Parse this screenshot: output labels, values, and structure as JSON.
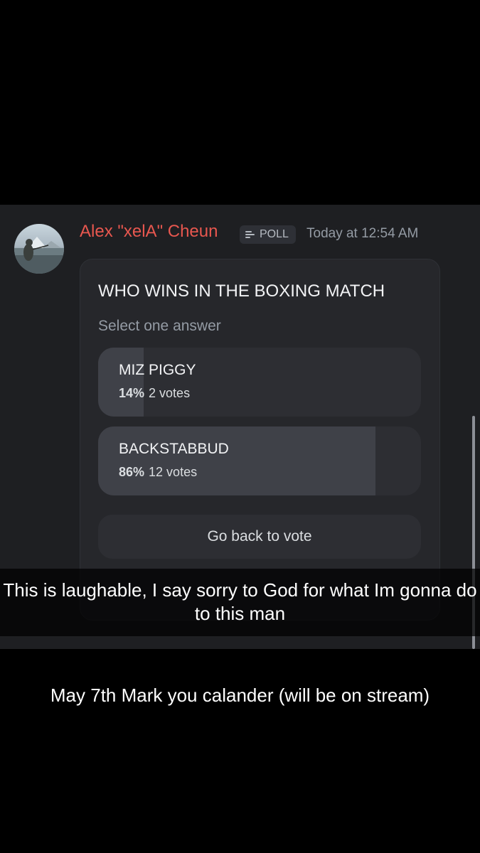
{
  "message": {
    "author": "Alex \"xelA\" Cheun",
    "author_color": "#e8574f",
    "tag": {
      "icon": "poll-icon",
      "label": "POLL"
    },
    "timestamp": "Today at 12:54 AM",
    "avatar": {
      "description_icon": "avatar"
    }
  },
  "poll": {
    "question": "WHO WINS IN THE BOXING MATCH",
    "instruction": "Select one answer",
    "answers": [
      {
        "label": "MIZ PIGGY",
        "percent": "14%",
        "votes": "2 votes",
        "fraction": 0.14
      },
      {
        "label": "BACKSTABBUD",
        "percent": "86%",
        "votes": "12 votes",
        "fraction": 0.86
      }
    ],
    "action_label": "Go back to vote"
  },
  "overlay": {
    "caption": "This is laughable, I say sorry to God for what Im gonna do to this man",
    "bottom_caption": "May 7th Mark you calander (will be on stream)"
  }
}
